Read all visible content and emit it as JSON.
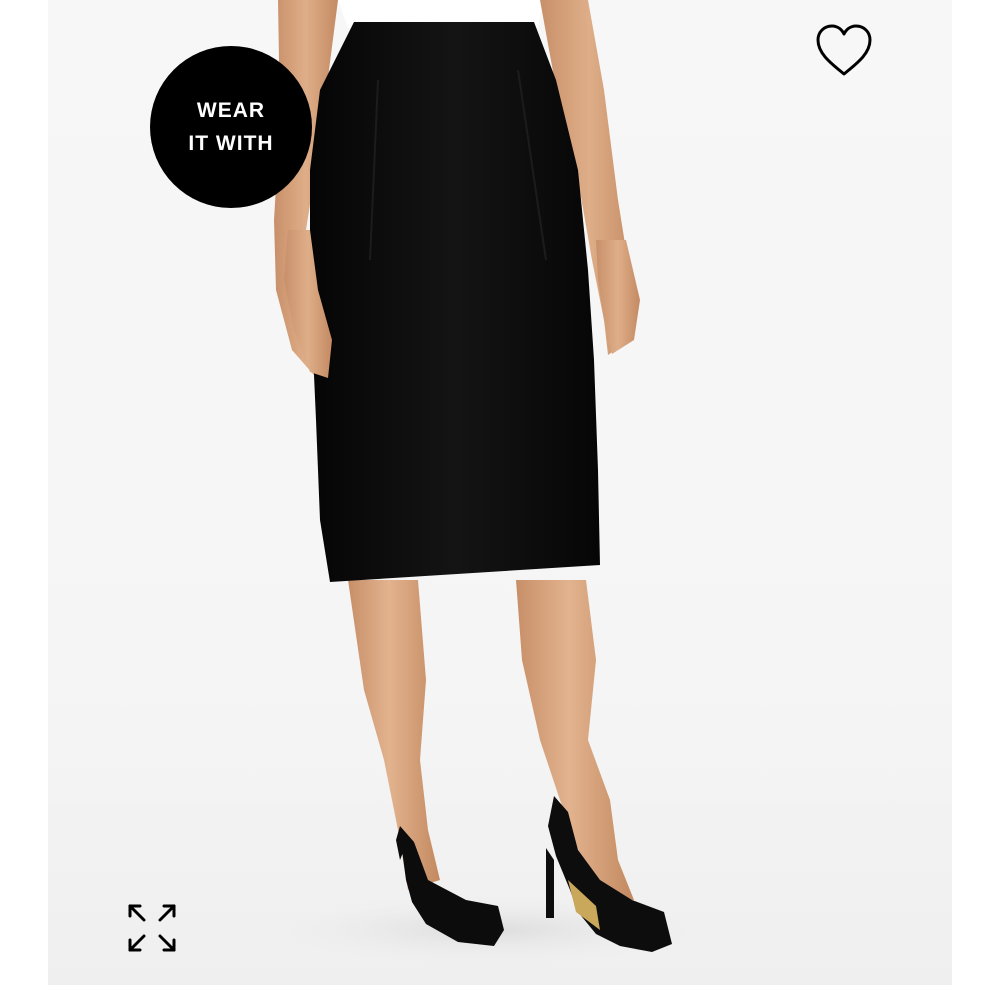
{
  "product": {
    "image_description_alt": "",
    "badge": {
      "line1": "WEAR",
      "line2": "IT WITH",
      "background": "#000000",
      "text_color": "#ffffff"
    },
    "favorite": {
      "icon": "heart-outline-icon",
      "stroke_color": "#000000"
    },
    "expand": {
      "icon": "expand-arrows-icon",
      "stroke_color": "#000000"
    }
  },
  "colors": {
    "page_background": "#ffffff",
    "image_background": "#f6f6f6",
    "skirt": "#0b0b0b",
    "skin": "#d9a57e",
    "top": "#ffffff"
  }
}
